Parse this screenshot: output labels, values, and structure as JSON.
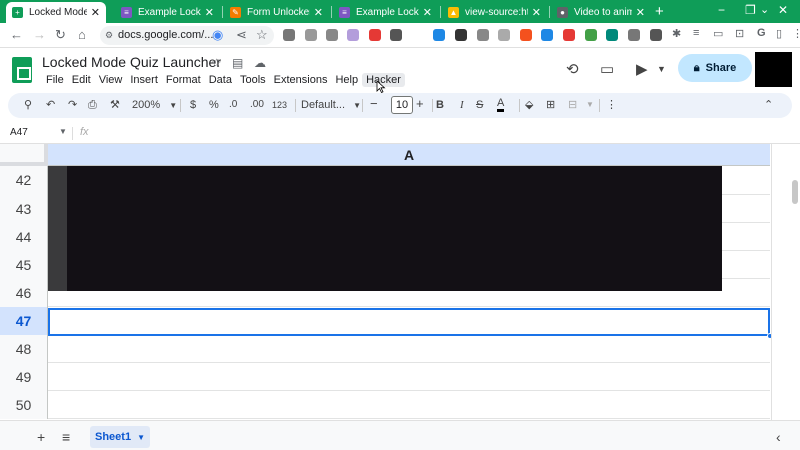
{
  "browser": {
    "tabs": [
      {
        "title": "Locked Mode Qui",
        "favicon_color": "#0f9d58",
        "active": true
      },
      {
        "title": "Example Locked",
        "favicon_color": "#7e57c2",
        "active": false
      },
      {
        "title": "Form Unlocker -",
        "favicon_color": "#f57c00",
        "active": false
      },
      {
        "title": "Example Locked",
        "favicon_color": "#7e57c2",
        "active": false
      },
      {
        "title": "view-source:http",
        "favicon_color": "#fbbc04",
        "active": false
      },
      {
        "title": "Video to animate",
        "favicon_color": "#5f6368",
        "active": false
      }
    ],
    "url": "docs.google.com/..."
  },
  "doc": {
    "title": "Locked Mode Quiz Launcher",
    "menu": [
      "File",
      "Edit",
      "View",
      "Insert",
      "Format",
      "Data",
      "Tools",
      "Extensions",
      "Help",
      "Hacker"
    ],
    "hovered_menu": "Hacker",
    "share_label": "Share"
  },
  "toolbar": {
    "zoom": "200%",
    "currency": "$",
    "percent": "%",
    "decrease_decimal": ".0",
    "increase_decimal": ".00",
    "number_format": "123",
    "font": "Default...",
    "font_size": "10",
    "bold": "B",
    "italic": "I",
    "text_color": "A"
  },
  "formula_bar": {
    "cell_ref": "A47",
    "fx": "fx"
  },
  "grid": {
    "column": "A",
    "rows": [
      "42",
      "43",
      "44",
      "45",
      "46",
      "47",
      "48",
      "49",
      "50"
    ],
    "selected_row": "47"
  },
  "sheet_tabs": {
    "active": "Sheet1"
  },
  "colors": {
    "sheets_green": "#0f9d58",
    "selection_blue": "#1a73e8",
    "header_highlight": "#d3e3fd",
    "share_bg": "#c2e7ff"
  }
}
